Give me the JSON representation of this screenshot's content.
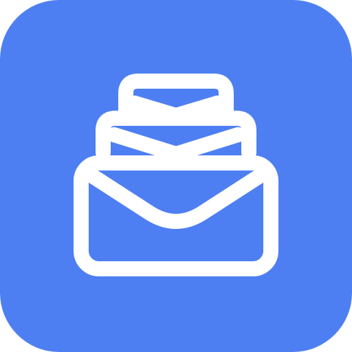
{
  "icon": {
    "name": "stacked-mail-envelopes",
    "background_color": "#4E7FF2",
    "stroke_color": "#FFFFFF"
  }
}
